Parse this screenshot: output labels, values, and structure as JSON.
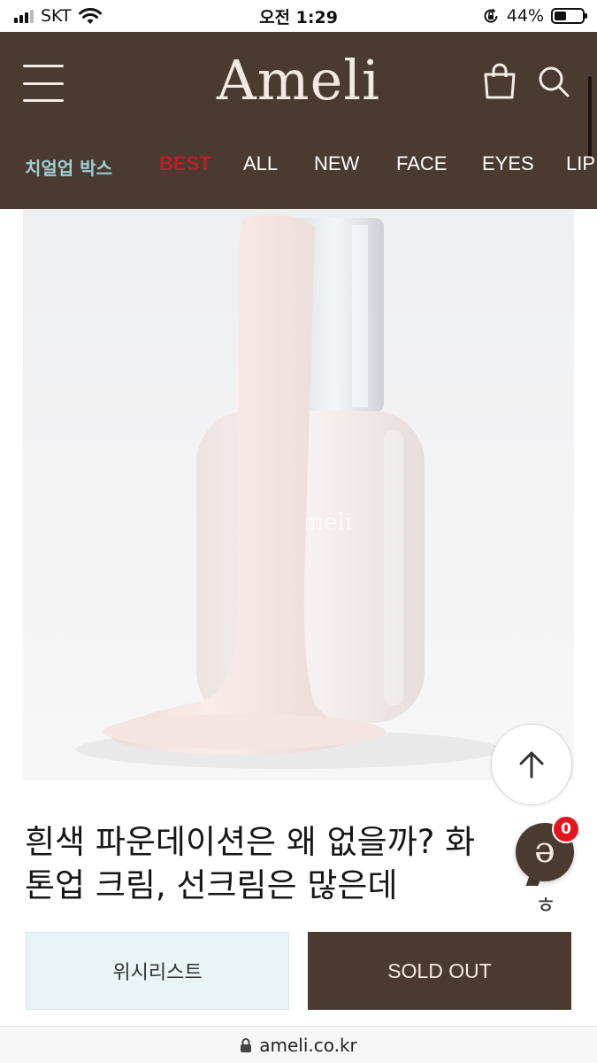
{
  "status_bar": {
    "carrier": "SKT",
    "time": "오전 1:29",
    "battery": "44%",
    "battery_level": 0.44
  },
  "header": {
    "logo": "Ameli",
    "nav": [
      {
        "label": "치얼업 박스"
      },
      {
        "label": "BEST"
      },
      {
        "label": "ALL"
      },
      {
        "label": "NEW"
      },
      {
        "label": "FACE"
      },
      {
        "label": "EYES"
      },
      {
        "label": "LIP"
      }
    ]
  },
  "product": {
    "title_line1": "흰색 파운데이션은 왜 없을까? 화",
    "title_line2": "톤업 크림, 선크림은 많은데",
    "bottle_brand": "ameli",
    "partial_text": "ㅎ"
  },
  "chat": {
    "letter": "ə",
    "badge": "0"
  },
  "actions": {
    "wishlist": "위시리스트",
    "sold_out": "SOLD OUT"
  },
  "browser": {
    "url": "ameli.co.kr"
  },
  "colors": {
    "header_bg": "#4a3a30",
    "accent_best": "#b5212d",
    "accent_box": "#9fcfd8",
    "wishlist_bg": "#e8f4f6",
    "badge": "#e4141e"
  }
}
